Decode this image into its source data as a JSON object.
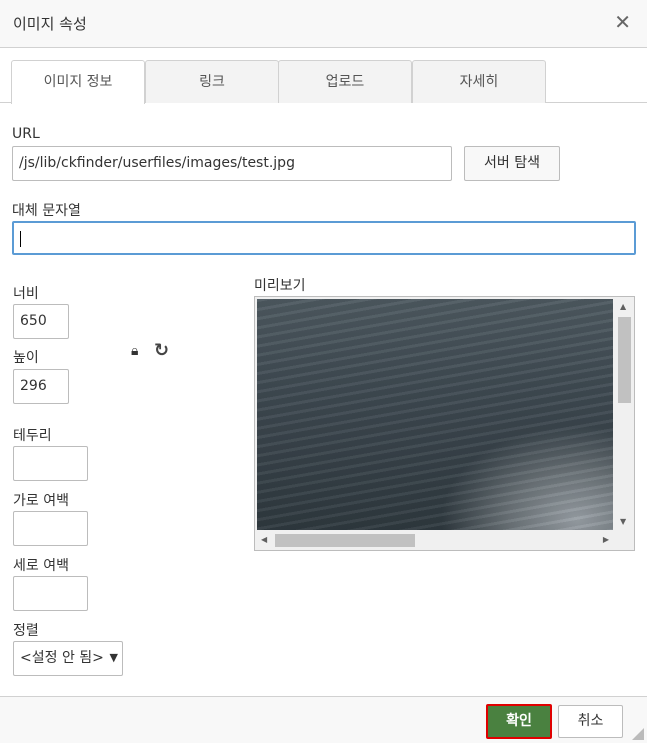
{
  "dialog": {
    "title": "이미지 속성",
    "close_icon": "close-icon"
  },
  "tabs": [
    {
      "label": "이미지 정보"
    },
    {
      "label": "링크"
    },
    {
      "label": "업로드"
    },
    {
      "label": "자세히"
    }
  ],
  "form": {
    "url_label": "URL",
    "url_value": "/js/lib/ckfinder/userfiles/images/test.jpg",
    "browse_label": "서버 탐색",
    "alt_label": "대체 문자열",
    "alt_value": "",
    "width_label": "너비",
    "width_value": "650",
    "height_label": "높이",
    "height_value": "296",
    "border_label": "테두리",
    "hspace_label": "가로 여백",
    "vspace_label": "세로 여백",
    "align_label": "정렬",
    "align_value": "<설정 안 됨>",
    "preview_label": "미리보기"
  },
  "footer": {
    "ok_label": "확인",
    "cancel_label": "취소"
  },
  "colors": {
    "ok": "#4a8140",
    "focus": "#5b9bd5",
    "highlight": "#e00000"
  }
}
